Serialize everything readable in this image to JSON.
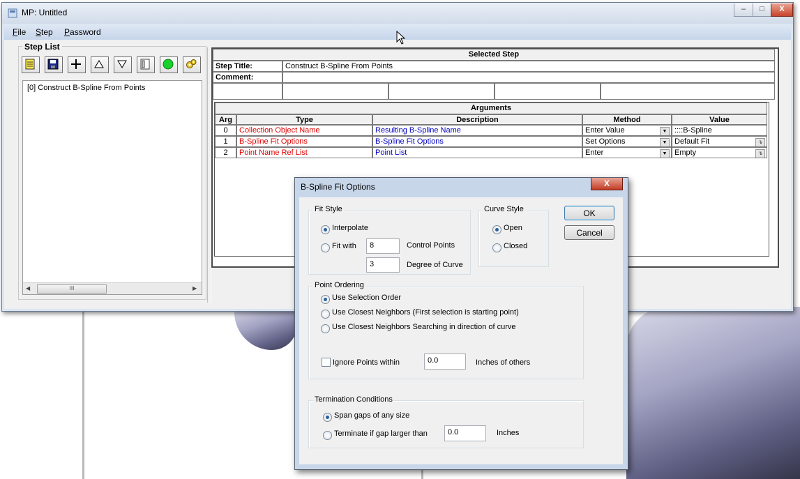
{
  "window": {
    "title": "MP: Untitled",
    "controls": {
      "minimize": "–",
      "maximize": "□",
      "close": "X"
    }
  },
  "menu": {
    "items": [
      {
        "label": "File",
        "accel": "F",
        "rest": "ile"
      },
      {
        "label": "Step",
        "accel": "S",
        "rest": "tep"
      },
      {
        "label": "Password",
        "accel": "P",
        "rest": "assword"
      }
    ]
  },
  "step_list": {
    "title": "Step List",
    "toolbar_icons": [
      "new-step-icon",
      "save-icon",
      "add-icon",
      "move-up-icon",
      "move-down-icon",
      "list-icon",
      "run-icon",
      "settings-icon"
    ],
    "items": [
      "[0] Construct B-Spline From Points"
    ],
    "scroll_thumb": "III"
  },
  "selected_step": {
    "header": "Selected Step",
    "step_title_label": "Step Title:",
    "step_title_value": "Construct B-Spline From Points",
    "comment_label": "Comment:",
    "comment_value": ""
  },
  "arguments": {
    "header": "Arguments",
    "columns": [
      "Arg",
      "Type",
      "Description",
      "Method",
      "Value"
    ],
    "rows": [
      {
        "arg": "0",
        "type": "Collection Object Name",
        "description": "Resulting B-Spline Name",
        "method": "Enter Value",
        "value": "::::B-Spline"
      },
      {
        "arg": "1",
        "type": "B-Spline Fit Options",
        "description": "B-Spline Fit Options",
        "method": "Set Options",
        "value": "Default Fit"
      },
      {
        "arg": "2",
        "type": "Point Name Ref List",
        "description": "Point List",
        "method": "Enter",
        "value": "Empty"
      }
    ]
  },
  "dialog": {
    "title": "B-Spline Fit Options",
    "close": "X",
    "fit_style": {
      "label": "Fit Style",
      "interpolate": "Interpolate",
      "fit_with": "Fit with",
      "control_points_value": "8",
      "control_points_label": "Control Points",
      "degree_value": "3",
      "degree_label": "Degree of Curve",
      "selected": "interpolate"
    },
    "curve_style": {
      "label": "Curve Style",
      "open": "Open",
      "closed": "Closed",
      "selected": "open"
    },
    "ok": "OK",
    "cancel": "Cancel",
    "point_ordering": {
      "label": "Point Ordering",
      "use_selection_order": "Use Selection Order",
      "closest_neighbors": "Use Closest Neighbors (First selection is starting point)",
      "closest_neighbors_direction": "Use Closest Neighbors Searching in direction of curve",
      "selected": "use_selection_order",
      "ignore_points_label": "Ignore Points within",
      "ignore_points_value": "0.0",
      "ignore_points_unit": "Inches of others",
      "ignore_points_checked": false
    },
    "termination": {
      "label": "Termination Conditions",
      "span_gaps": "Span gaps of any size",
      "terminate_if": "Terminate if gap larger than",
      "gap_value": "0.0",
      "gap_unit": "Inches",
      "selected": "span_gaps"
    }
  }
}
